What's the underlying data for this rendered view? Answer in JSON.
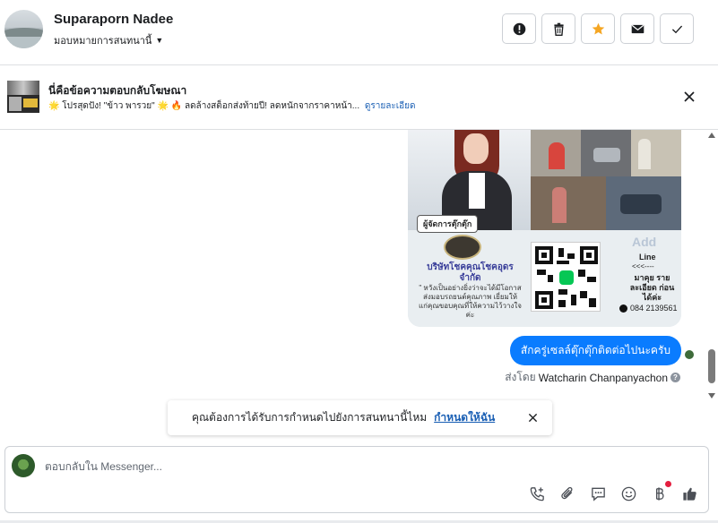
{
  "header": {
    "user_name": "Suparaporn Nadee",
    "assign_label": "มอบหมายการสนทนานี้",
    "buttons": [
      "spam-icon",
      "trash-icon",
      "star-icon",
      "mail-icon",
      "check-icon"
    ],
    "accent_star": "#f5a623"
  },
  "ad_banner": {
    "title": "นี่คือข้อความตอบกลับโฆษณา",
    "subtitle": "🌟 โปรสุดปัง! \"ข้าว พารวย\" 🌟 🔥 ลดล้างสต็อกส่งท้ายปี! ลดหนักจากราคาหน้า...",
    "detail_link": "ดูรายละเอียด"
  },
  "poster": {
    "tag": "ผู้จัดการตุ๊กตุ๊ก",
    "company": "บริษัทโชคคุณโชคอุดร จำกัด",
    "slogan": "\" หวังเป็นอย่างยิ่งว่าจะได้มีโอกาสส่งมอบรถยนต์คุณภาพ เยี่ยมให้แก่คุณขอบคุณที่ให้ความไว้วางใจค่ะ",
    "add": "Add",
    "line": "Line",
    "arrows": "<<<----",
    "detail": "มาคุย รายละเอียด ก่อนได้ค่ะ",
    "phone": "084 2139561"
  },
  "chat": {
    "message": "สักครู่เซลล์ตุ๊กตุ๊กติดต่อไปนะครับ",
    "sent_by_prefix": "ส่งโดย",
    "sent_by_name": "Watcharin Chanpanyachon",
    "bubble_color": "#0a7cff"
  },
  "assign_prompt": {
    "text": "คุณต้องการได้รับการกำหนดไปยังการสนทนานี้ไหม",
    "link": "กำหนดให้ฉัน"
  },
  "composer": {
    "placeholder": "ตอบกลับใน Messenger...",
    "icons": [
      "call-add-icon",
      "attachment-icon",
      "saved-reply-icon",
      "emoji-icon",
      "baht-icon",
      "like-icon"
    ]
  }
}
